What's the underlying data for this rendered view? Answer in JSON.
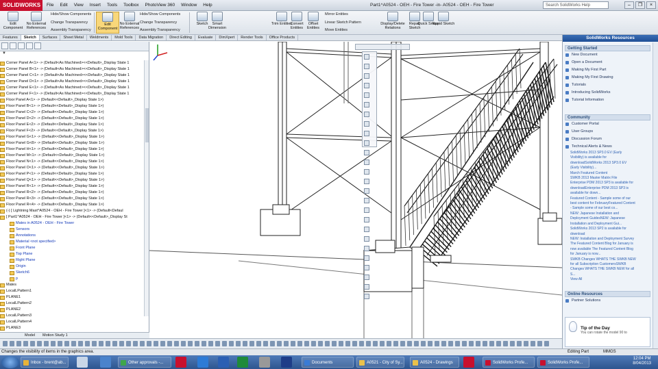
{
  "app": {
    "logo": "SOLIDWORKS",
    "title": "Part1^A0524 - OEH - Fire Tower -in- A0524 - OEH - Fire Tower",
    "menu": [
      "File",
      "Edit",
      "View",
      "Insert",
      "Tools",
      "Toolbox",
      "PhotoView 360",
      "Window",
      "Help"
    ],
    "search_placeholder": "Search SolidWorks Help"
  },
  "ribbon": {
    "edit_component": "Edit Component",
    "no_external_refs": "No External References",
    "hide_show": "Hide/Show Components",
    "change_transparency": "Change Transparency",
    "assembly_transparency": "Assembly Transparency",
    "sketch": "Sketch",
    "smart_dimension": "Smart Dimension",
    "trim_entities": "Trim Entities",
    "convert_entities": "Convert Entities",
    "offset_entities": "Offset Entities",
    "mirror_entities": "Mirror Entities",
    "linear_sketch_pattern": "Linear Sketch Pattern",
    "move_entities": "Move Entities",
    "display_delete_relations": "Display/Delete Relations",
    "repair_sketch": "Repair Sketch",
    "quick_snaps": "Quick Snaps",
    "rapid_sketch": "Rapid Sketch"
  },
  "tabs": [
    "Features",
    "Sketch",
    "Surfaces",
    "Sheet Metal",
    "Weldments",
    "Mold Tools",
    "Data Migration",
    "Direct Editing",
    "Evaluate",
    "DimXpert",
    "Render Tools",
    "Office Products"
  ],
  "active_tab": "Sketch",
  "tree": [
    "Corner Panel A<1> -> (Default<As Machined><<Default>_Display State 1",
    "Corner Panel B<1> -> (Default<As Machined><<Default>_Display State 1",
    "Corner Panel C<1> -> (Default<As Machined><<Default>_Display State 1",
    "Corner Panel D<1> -> (Default<As Machined><<Default>_Display State 1",
    "Corner Panel E<1> -> (Default<As Machined><<Default>_Display State 1",
    "Corner Panel F<1> -> (Default<As Machined><<Default>_Display State 1",
    "Floor Panel A<1> -> (Default<<Default>_Display State 1>)",
    "Floor Panel B<1> -> (Default<<Default>_Display State 1>)",
    "Floor Panel C<2> -> (Default<<Default>_Display State 1>)",
    "Floor Panel D<2> -> (Default<<Default>_Display State 1>)",
    "Floor Panel E<2> -> (Default<<Default>_Display State 1>)",
    "Floor Panel F<2> -> (Default<<Default>_Display State 1>)",
    "Floor Panel G<1> -> (Default<<Default>_Display State 1>)",
    "Floor Panel G<8> -> (Default<<Default>_Display State 1>)",
    "Floor Panel H<1> -> (Default<<Default>_Display State 1>)",
    "Floor Panel M<1> -> (Default<<Default>_Display State 1>)",
    "Floor Panel N<1> -> (Default<<Default>_Display State 1>)",
    "Floor Panel O<1> -> (Default<<Default>_Display State 1>)",
    "Floor Panel P<1> -> (Default<<Default>_Display State 1>)",
    "Floor Panel Q<1> -> (Default<<Default>_Display State 1>)",
    "Floor Panel R<1> -> (Default<<Default>_Display State 1>)",
    "Floor Panel R<2> -> (Default<<Default>_Display State 1>)",
    "Floor Panel R<3> -> (Default<<Default>_Display State 1>)",
    "Floor Panel R<4> -> (Default<<Default>_Display State 1>)",
    "(-) [ Lightning Mast^A0524 - OEH - Fire Tower ]<1> -> (Default<Defaul",
    "[ Part1^A0524 - OEH - Fire Tower ]<1> -> (Default<<Default>_Display St",
    "Mates in A0524 - OEH - Fire Tower",
    "Sensors",
    "Annotations",
    "Material <not specified>",
    "Front Plane",
    "Top Plane",
    "Right Plane",
    "Origin",
    "Sketch6",
    "p",
    "Mates",
    "LocalLPattern1",
    "PLANE1",
    "LocalLPattern2",
    "PLANE2",
    "LocalLPattern3",
    "LocalLPattern4",
    "PLANE3",
    "Plane1"
  ],
  "model_tabs": [
    "Model",
    "Motion Study 1"
  ],
  "task_pane": {
    "header": "SolidWorks Resources",
    "getting_started_title": "Getting Started",
    "getting_started": [
      "New Document",
      "Open a Document",
      "Making My First Part",
      "Making My First Drawing",
      "Tutorials",
      "Introducing SolidWorks",
      "Tutorial Information"
    ],
    "community_title": "Community",
    "community": [
      "Customer Portal",
      "User Groups",
      "Discussion Forum",
      "Technical Alerts & News"
    ],
    "news": [
      "SolidWorks 2013 SP3.0 EV (Early",
      "Visibility) is available for",
      "downloadSolidWorks 2013 SP3.0 EV",
      "(Early Visibility)...",
      "March Featured Content",
      "SWKB 2013 Master Matrix File",
      "Enterprise PDM 2013 SP3 is available for",
      "downloadEnterprise PDM 2013 SP3 is",
      "available for down...",
      "Featured Content - Sample some of our",
      "best content for FebruaryFeatured Content",
      "- Sample some of our best co...",
      "NEW: Japanese Installation and",
      "Deployment GuidesNEW: Japanese",
      "Installation and Deployment Gui...",
      "SolidWorks 2013 SP2 is available for",
      "download",
      "NEW: Installation and Deployment Survey",
      "The Featured Content Blog for January is",
      "now available The Featured Content Blog",
      "for January is now...",
      "SWKB Changes WHATS THE SWKB NEW",
      "for all Subscription CustomersSWKB",
      "Changes WHATS THE SWKB NEW for all",
      "S..."
    ],
    "view_all": "View All",
    "online_resources_title": "Online Resources",
    "online_resources": [
      "Partner Solutions"
    ],
    "tip_title": "Tip of the Day",
    "tip_text": "You can rotate the model 90 to"
  },
  "status": {
    "message": "Changes the visibility of items in the graphics area.",
    "mode": "Editing Part",
    "units": "MMGS"
  },
  "taskbar": {
    "items": [
      "Inbox - brent@ab...",
      "Other approvals -...",
      "Documents",
      "A0521 - City of Sy...",
      "A0524 - Drawings",
      "SolidWorks Profe...",
      "SolidWorks Profe..."
    ],
    "time": "12:04 PM",
    "date": "8/04/2013"
  }
}
